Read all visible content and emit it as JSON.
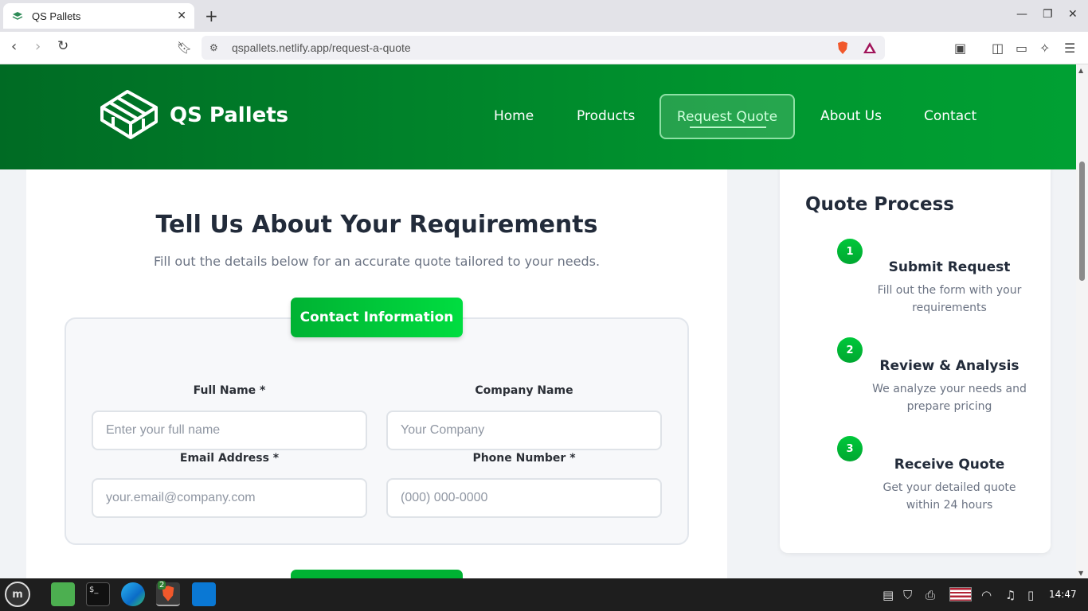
{
  "browser": {
    "tab_title": "QS Pallets",
    "url_host": "qspallets.netlify.app",
    "url_path": "/request-a-quote"
  },
  "header": {
    "brand": "QS Pallets",
    "nav": [
      "Home",
      "Products",
      "Request Quote",
      "About Us",
      "Contact"
    ],
    "active_nav": "Request Quote"
  },
  "form": {
    "title": "Tell Us About Your Requirements",
    "subtitle": "Fill out the details below for an accurate quote tailored to your needs.",
    "section_label": "Contact Information",
    "fields": [
      {
        "label": "Full Name *",
        "placeholder": "Enter your full name",
        "value": ""
      },
      {
        "label": "Company Name",
        "placeholder": "Your Company",
        "value": ""
      },
      {
        "label": "Email Address *",
        "placeholder": "your.email@company.com",
        "value": ""
      },
      {
        "label": "Phone Number *",
        "placeholder": "(000) 000-0000",
        "value": ""
      }
    ]
  },
  "quote_process": {
    "title": "Quote Process",
    "steps": [
      {
        "num": "1",
        "title": "Submit Request",
        "desc": "Fill out the form with your requirements"
      },
      {
        "num": "2",
        "title": "Review & Analysis",
        "desc": "We analyze your needs and prepare pricing"
      },
      {
        "num": "3",
        "title": "Receive Quote",
        "desc": "Get your detailed quote within 24 hours"
      }
    ]
  },
  "taskbar": {
    "clock": "14:47",
    "brave_badge": "2"
  },
  "colors": {
    "header_green": "#00962f",
    "accent_green": "#00c83a"
  }
}
